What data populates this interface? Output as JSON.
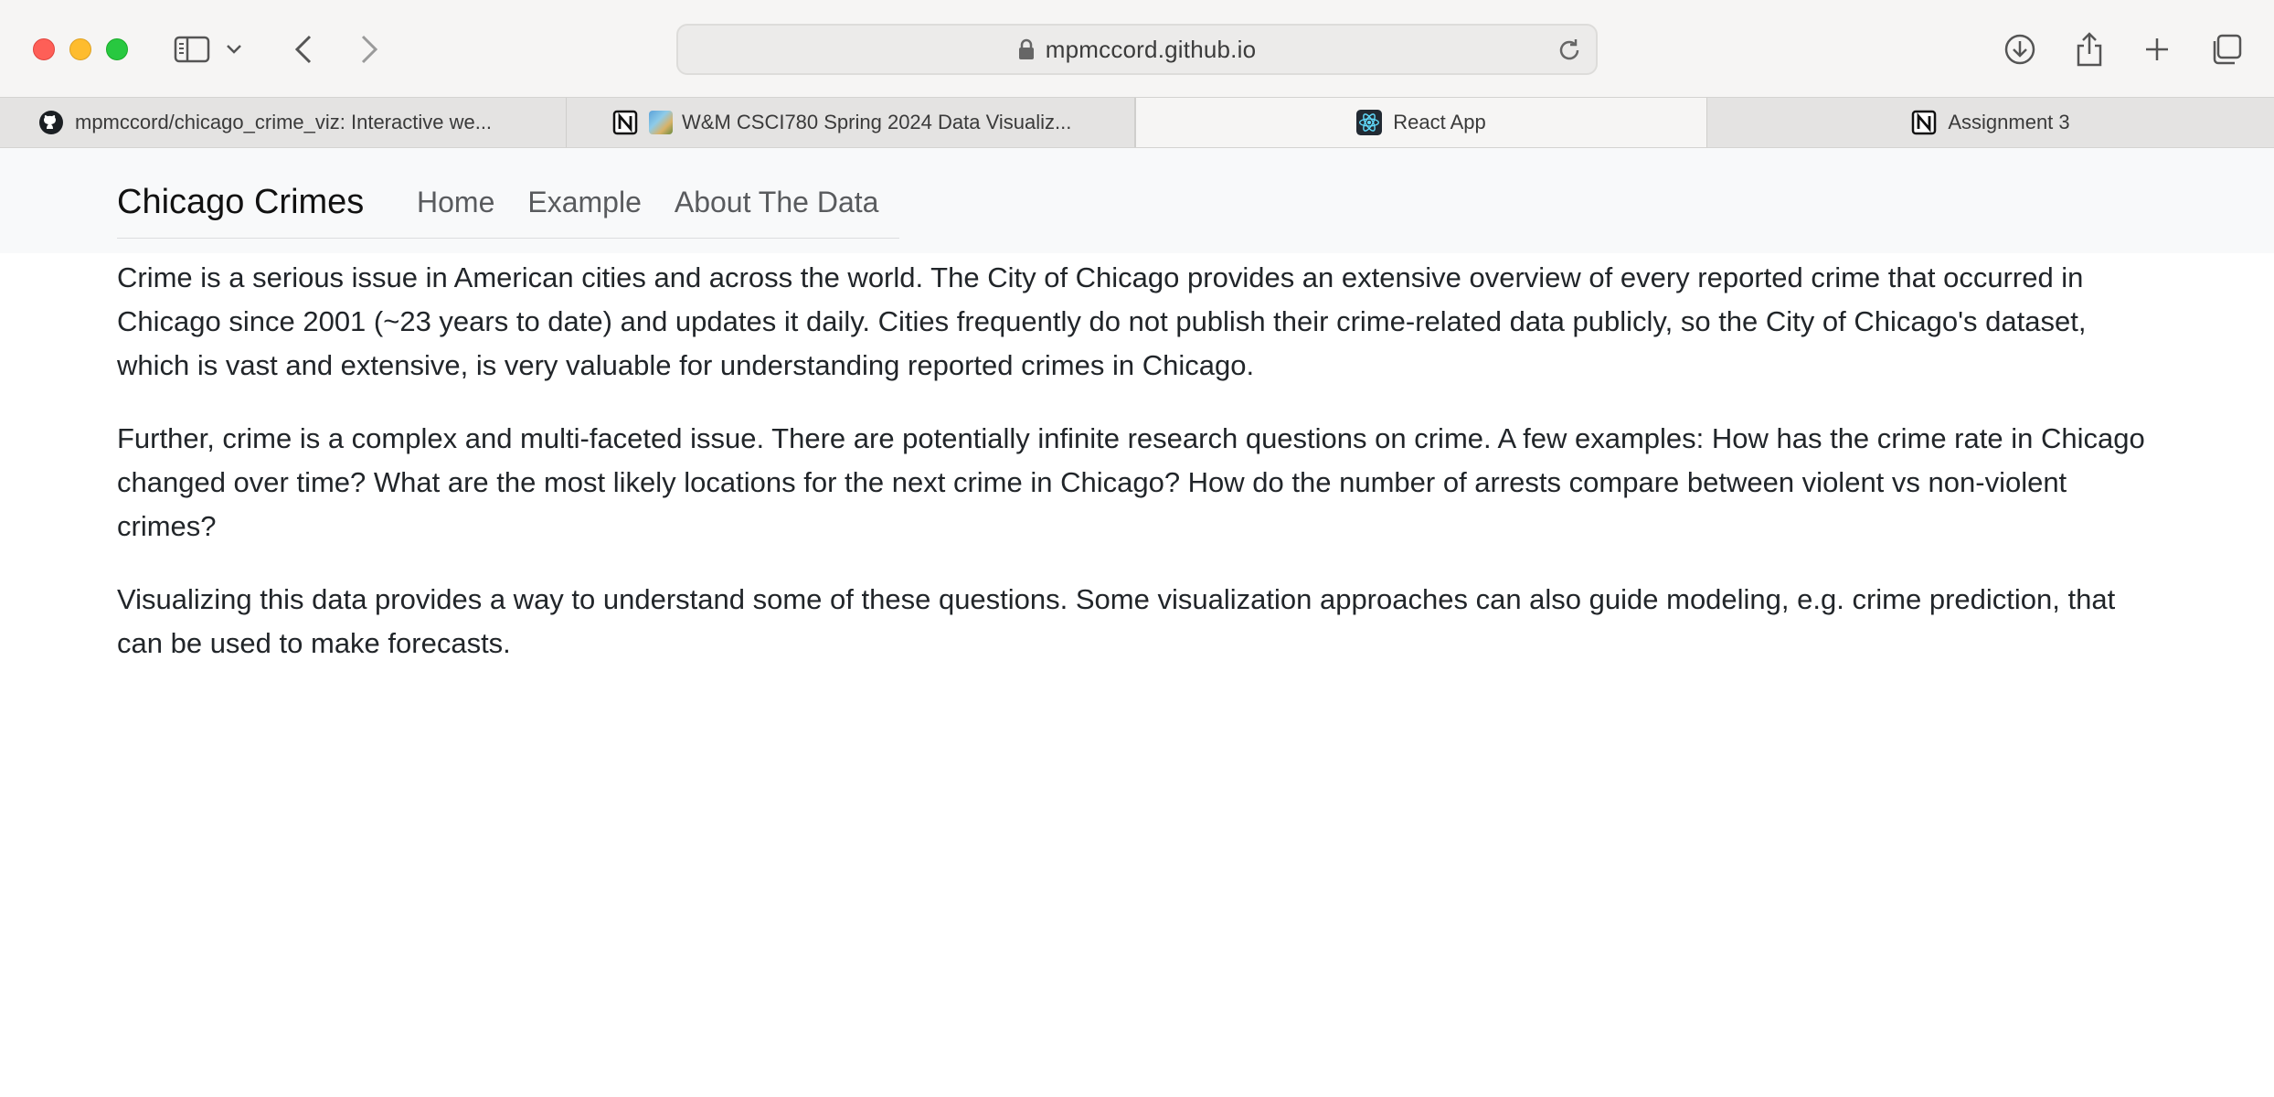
{
  "browser": {
    "url": "mpmccord.github.io",
    "tabs": [
      {
        "title": "mpmccord/chicago_crime_viz: Interactive we...",
        "favicon": "github-icon",
        "active": false
      },
      {
        "title": "W&M CSCI780 Spring 2024 Data Visualiz...",
        "favicon": "notion-icon",
        "active": false
      },
      {
        "title": "React App",
        "favicon": "react-icon",
        "active": true
      },
      {
        "title": "Assignment 3",
        "favicon": "notion-icon",
        "active": false
      }
    ]
  },
  "navbar": {
    "brand": "Chicago Crimes",
    "links": [
      "Home",
      "Example",
      "About The Data"
    ]
  },
  "content": {
    "paragraphs": [
      "Crime is a serious issue in American cities and across the world. The City of Chicago provides an extensive overview of every reported crime that occurred in Chicago since 2001 (~23 years to date) and updates it daily. Cities frequently do not publish their crime-related data publicly, so the City of Chicago's dataset, which is vast and extensive, is very valuable for understanding reported crimes in Chicago.",
      "Further, crime is a complex and multi-faceted issue. There are potentially infinite research questions on crime. A few examples: How has the crime rate in Chicago changed over time? What are the most likely locations for the next crime in Chicago? How do the number of arrests compare between violent vs non-violent crimes?",
      "Visualizing this data provides a way to understand some of these questions. Some visualization approaches can also guide modeling, e.g. crime prediction, that can be used to make forecasts."
    ]
  },
  "colors": {
    "traffic_red": "#fe5f57",
    "traffic_yellow": "#febc2e",
    "traffic_green": "#28c840",
    "navbar_bg": "#f8f9fa",
    "nav_link": "#595b5e"
  }
}
